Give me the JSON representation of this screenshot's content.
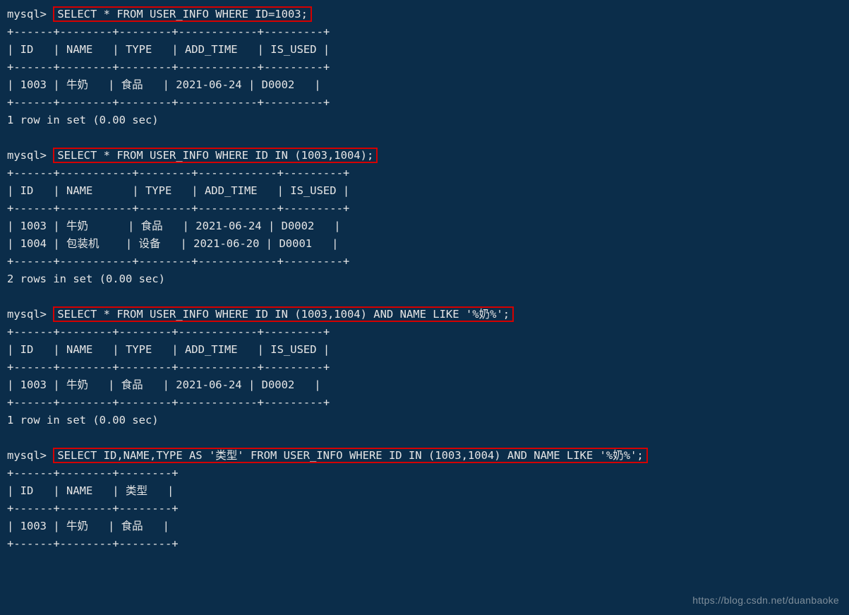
{
  "prompt": "mysql>",
  "queries": {
    "q1": "SELECT * FROM USER_INFO WHERE ID=1003;",
    "q2": "SELECT * FROM USER_INFO WHERE ID IN (1003,1004);",
    "q3": "SELECT * FROM USER_INFO WHERE ID IN (1003,1004) AND NAME LIKE '%奶%';",
    "q4": "SELECT ID,NAME,TYPE AS '类型' FROM USER_INFO WHERE ID IN (1003,1004) AND NAME LIKE '%奶%';"
  },
  "results": {
    "r1": {
      "border": "+------+--------+--------+------------+---------+",
      "header": "| ID   | NAME   | TYPE   | ADD_TIME   | IS_USED |",
      "rows": [
        "| 1003 | 牛奶   | 食品   | 2021-06-24 | D0002   |"
      ],
      "footer": "1 row in set (0.00 sec)"
    },
    "r2": {
      "border": "+------+-----------+--------+------------+---------+",
      "header": "| ID   | NAME      | TYPE   | ADD_TIME   | IS_USED |",
      "rows": [
        "| 1003 | 牛奶      | 食品   | 2021-06-24 | D0002   |",
        "| 1004 | 包装机    | 设备   | 2021-06-20 | D0001   |"
      ],
      "footer": "2 rows in set (0.00 sec)"
    },
    "r3": {
      "border": "+------+--------+--------+------------+---------+",
      "header": "| ID   | NAME   | TYPE   | ADD_TIME   | IS_USED |",
      "rows": [
        "| 1003 | 牛奶   | 食品   | 2021-06-24 | D0002   |"
      ],
      "footer": "1 row in set (0.00 sec)"
    },
    "r4": {
      "border": "+------+--------+--------+",
      "header": "| ID   | NAME   | 类型   |",
      "rows": [
        "| 1003 | 牛奶   | 食品   |"
      ]
    }
  },
  "watermark": "https://blog.csdn.net/duanbaoke"
}
